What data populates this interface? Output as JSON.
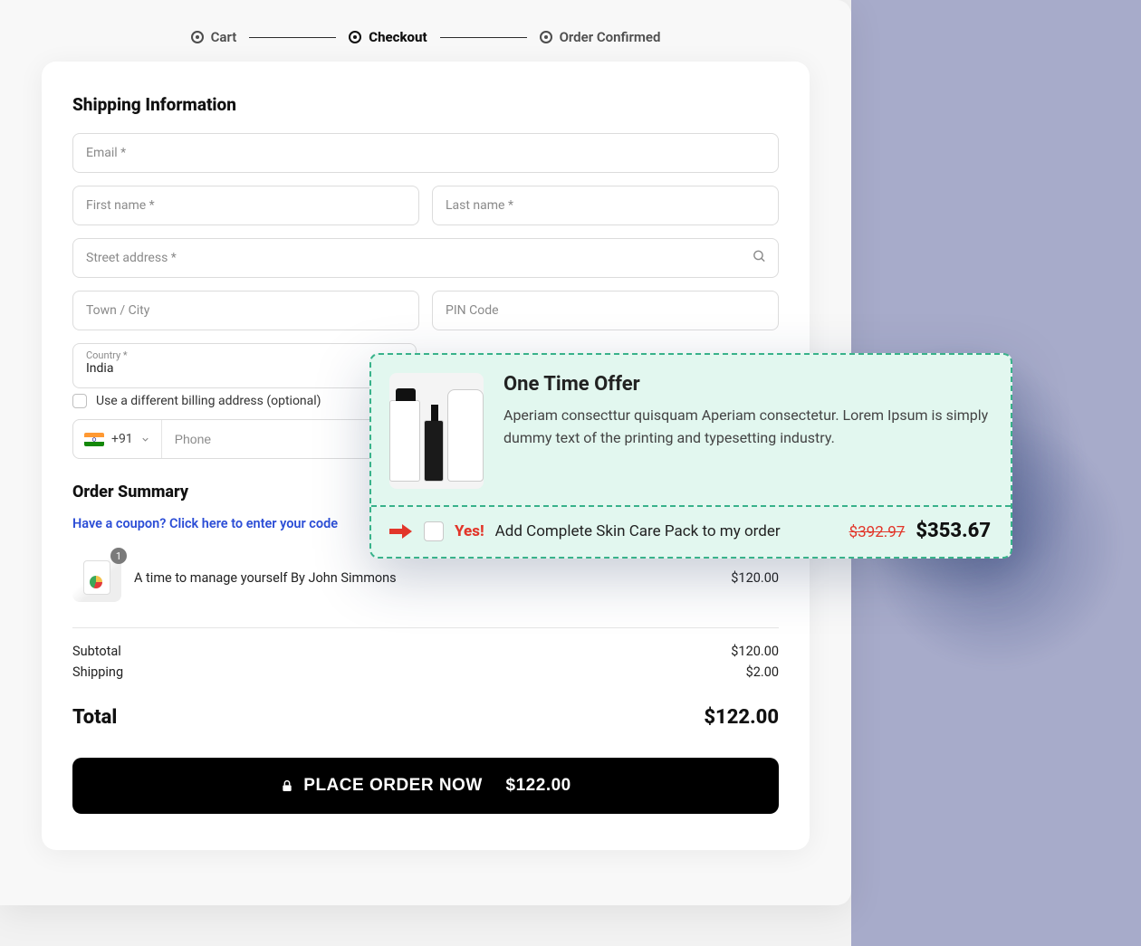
{
  "steps": {
    "cart": "Cart",
    "checkout": "Checkout",
    "confirmed": "Order Confirmed"
  },
  "shipping": {
    "title": "Shipping Information",
    "email_ph": "Email *",
    "first_name_ph": "First name *",
    "last_name_ph": "Last name *",
    "street_ph": "Street address *",
    "city_ph": "Town / City",
    "pin_ph": "PIN Code",
    "country_label": "Country *",
    "country_value": "India",
    "diff_billing_label": "Use a different billing address (optional)",
    "phone_prefix": "+91",
    "phone_ph": "Phone"
  },
  "order_summary": {
    "title": "Order Summary",
    "coupon_text": "Have a coupon? Click here to enter your code",
    "item": {
      "qty": "1",
      "name": "A time to manage yourself By John Simmons",
      "price": "$120.00"
    },
    "subtotal_label": "Subtotal",
    "subtotal_value": "$120.00",
    "shipping_label": "Shipping",
    "shipping_value": "$2.00",
    "total_label": "Total",
    "total_value": "$122.00"
  },
  "place_order": {
    "label": "PLACE ORDER NOW",
    "amount": "$122.00"
  },
  "offer": {
    "title": "One Time Offer",
    "desc": "Aperiam consecttur quisquam Aperiam consectetur. Lorem Ipsum is simply dummy text of the printing and typesetting industry.",
    "yes": "Yes!",
    "add_text": "Add Complete Skin Care Pack to my order",
    "strike_price": "$392.97",
    "price": "$353.67"
  }
}
